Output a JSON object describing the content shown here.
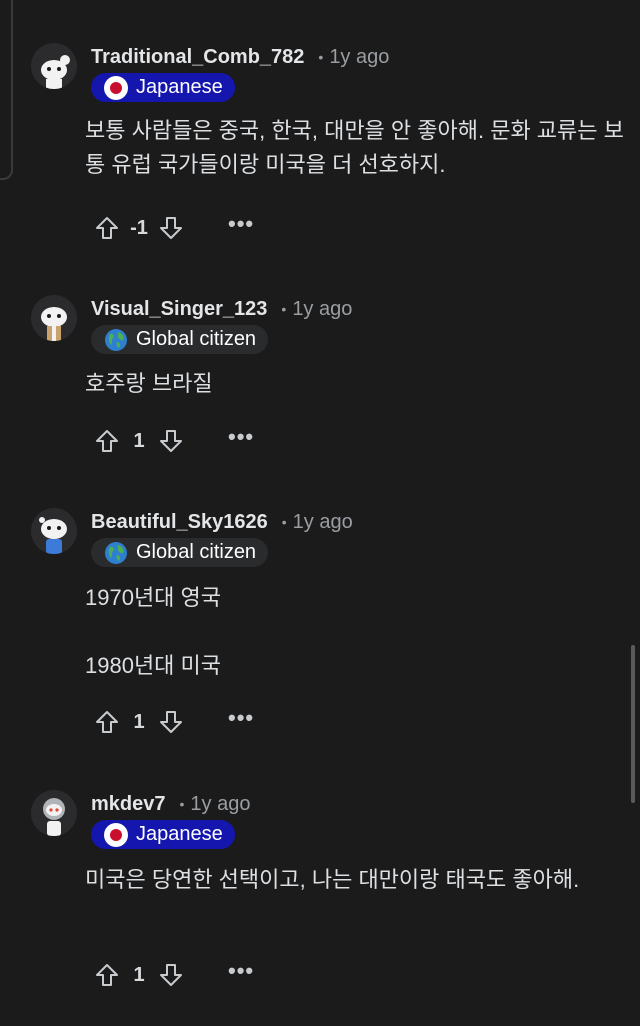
{
  "comments": [
    {
      "username": "Traditional_Comb_782",
      "dot": "•",
      "time": "1y ago",
      "flair": "Japanese",
      "flair_icon": "japan-flag-icon",
      "body": [
        "보통 사람들은 중국, 한국, 대만을 안 좋아해. 문화 교류는 보통 유럽 국가들이랑 미국을 더 선호하지."
      ],
      "score": "-1"
    },
    {
      "username": "Visual_Singer_123",
      "dot": "•",
      "time": "1y ago",
      "flair": "Global citizen",
      "flair_icon": "globe-icon",
      "body": [
        "호주랑 브라질"
      ],
      "score": "1"
    },
    {
      "username": "Beautiful_Sky1626",
      "dot": "•",
      "time": "1y ago",
      "flair": "Global citizen",
      "flair_icon": "globe-icon",
      "body": [
        "1970년대 영국",
        "1980년대 미국"
      ],
      "score": "1"
    },
    {
      "username": "mkdev7",
      "dot": "•",
      "time": "1y ago",
      "flair": "Japanese",
      "flair_icon": "japan-flag-icon",
      "body": [
        "미국은 당연한 선택이고, 나는 대만이랑 태국도 좋아해."
      ],
      "score": "1"
    }
  ],
  "more_label": "•••",
  "colors": {
    "background": "#1b1b1c",
    "japanese_flair": "#1416ae",
    "global_flair": "#2a2b2d",
    "text": "#d7dadc",
    "muted": "#9a9ea2"
  }
}
